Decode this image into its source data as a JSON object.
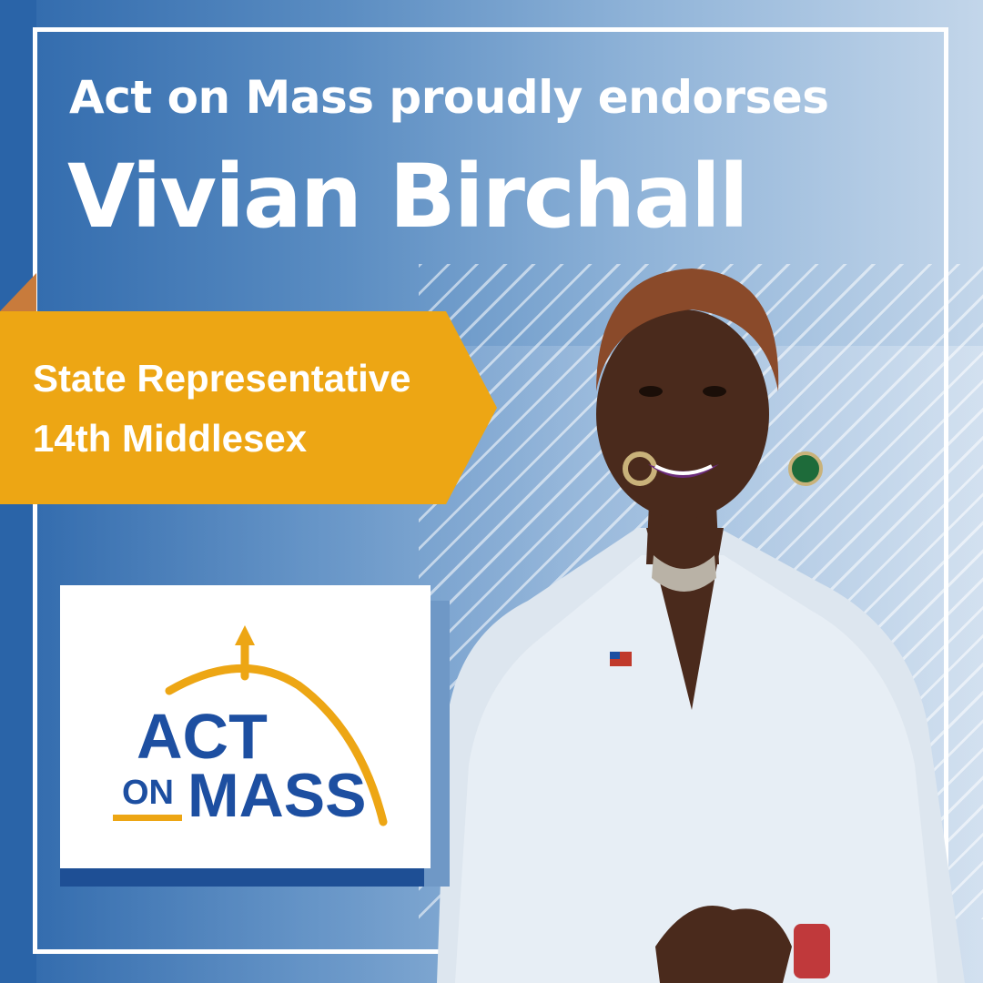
{
  "headline": "Act on Mass proudly endorses",
  "candidate_name": "Vivian Birchall",
  "office": {
    "line1": "State Representative",
    "line2": "14th Middlesex"
  },
  "logo": {
    "word_act": "ACT",
    "word_on": "ON",
    "word_mass": "MASS"
  },
  "colors": {
    "brand_blue": "#1d4fa1",
    "brand_gold": "#eda614",
    "background_blue": "#2f69ac"
  }
}
